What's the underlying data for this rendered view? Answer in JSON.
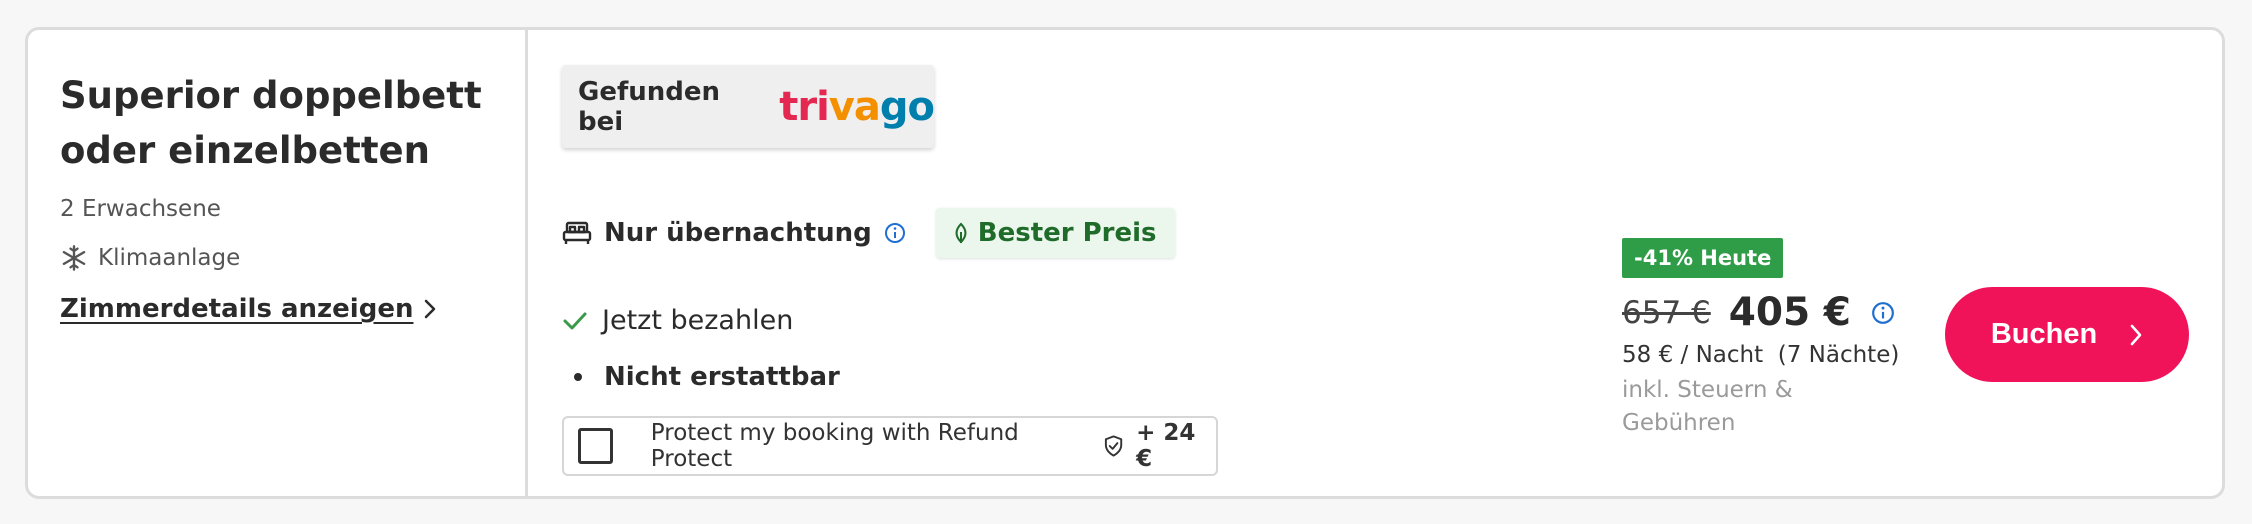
{
  "room": {
    "title": "Superior doppelbett oder einzelbetten",
    "guests": "2 Erwachsene",
    "amenity": "Klimaanlage",
    "amenity_icon": "snowflake-icon",
    "details_link": "Zimmerdetails anzeigen"
  },
  "offer": {
    "found_label": "Gefunden bei",
    "brand": {
      "part1": "tri",
      "part2": "va",
      "part3": "go"
    },
    "rate_name": "Nur übernachtung",
    "best_price": "Bester Preis",
    "payment": "Jetzt bezahlen",
    "refund_policy": "Nicht erstattbar",
    "protect_text": "Protect my booking with Refund Protect",
    "protect_price": "+ 24 €",
    "protect_checked": false
  },
  "pricing": {
    "discount": "-41% Heute",
    "old_price": "657 €",
    "new_price": "405 €",
    "per_night": "58 € / Nacht  (7 Nächte)",
    "tax_note": "inkl. Steuern & Gebühren",
    "book_label": "Buchen"
  },
  "colors": {
    "brand_red": "#e32851",
    "brand_orange": "#f48f00",
    "brand_blue": "#007fad",
    "book_button": "#f0135a",
    "discount_badge": "#2f9d47",
    "best_price_bg": "#ebf6ec",
    "check_green": "#3a9a4a",
    "info_blue": "#1f6fd1"
  }
}
